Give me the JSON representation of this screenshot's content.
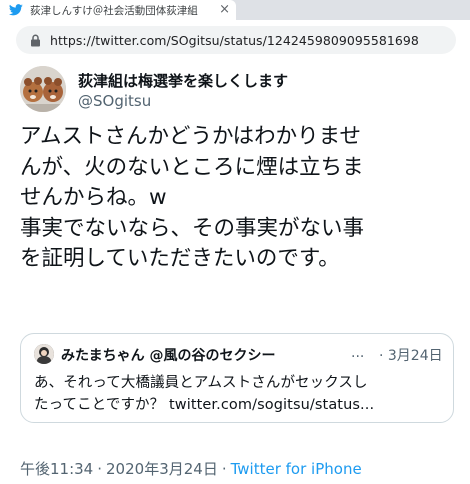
{
  "browser": {
    "tab_title": "荻津しんすけ＠社会活動団体荻津組",
    "tab_close": "×",
    "url": "https://twitter.com/SOgitsu/status/1242459809095581698"
  },
  "tweet": {
    "display_name": "荻津組は梅選挙を楽しくします",
    "handle": "@SOgitsu",
    "text_lines": [
      "アムストさんかどうかはわかりませ",
      "んが、火のないところに煙は立ちま",
      "せんからね。w",
      "事実でないなら、その事実がない事",
      "を証明していただきたいのです。"
    ],
    "quote": {
      "name": "みたまちゃん @風の谷のセクシー",
      "ellipsis": "...",
      "date": "· 3月24日",
      "text_lines": [
        "あ、それって大橋議員とアムストさんがセックスし",
        "たってことですか？ twitter.com/sogitsu/status..."
      ]
    },
    "meta": {
      "time": "午後11:34",
      "separator": "·",
      "date": "2020年3月24日",
      "source": "Twitter for iPhone"
    }
  }
}
